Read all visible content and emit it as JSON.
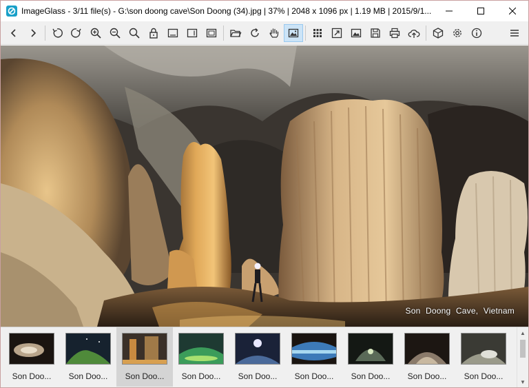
{
  "window": {
    "title": "ImageGlass - 3/11 file(s) - G:\\son doong cave\\Son Doong (34).jpg  |  37%  |  2048 x 1096 px  |  1.19 MB  |  2015/9/1...",
    "minimize_icon": "minimize-icon",
    "maximize_icon": "maximize-icon",
    "close_icon": "close-icon"
  },
  "toolbar": {
    "buttons": [
      "back-icon",
      "forward-icon",
      "rotate-left-icon",
      "rotate-right-icon",
      "zoom-in-icon",
      "zoom-out-icon",
      "zoom-fit-icon",
      "lock-zoom-icon",
      "scale-to-width-icon",
      "scale-to-height-icon",
      "scale-to-fill-icon",
      "open-file-icon",
      "refresh-icon",
      "pan-hand-icon",
      "view-image-icon",
      "thumbnail-grid-icon",
      "fullscreen-icon",
      "slideshow-icon",
      "save-icon",
      "print-icon",
      "upload-icon",
      "extension-icon",
      "settings-icon",
      "about-icon",
      "menu-icon"
    ],
    "active": "view-image-icon"
  },
  "viewer": {
    "caption": "Son Doong Cave, Vietnam"
  },
  "thumbnails": {
    "selected_index": 2,
    "items": [
      {
        "label": "Son Doo...",
        "tone": "#b8a48a"
      },
      {
        "label": "Son Doo...",
        "tone": "#4f8a3a"
      },
      {
        "label": "Son Doo...",
        "tone": "#a07a48"
      },
      {
        "label": "Son Doo...",
        "tone": "#3b9c5a"
      },
      {
        "label": "Son Doo...",
        "tone": "#4a6a9a"
      },
      {
        "label": "Son Doo...",
        "tone": "#3d7ab8"
      },
      {
        "label": "Son Doo...",
        "tone": "#5a6a58"
      },
      {
        "label": "Son Doo...",
        "tone": "#8a7a6a"
      },
      {
        "label": "Son Doo...",
        "tone": "#9a9a8a"
      }
    ]
  }
}
